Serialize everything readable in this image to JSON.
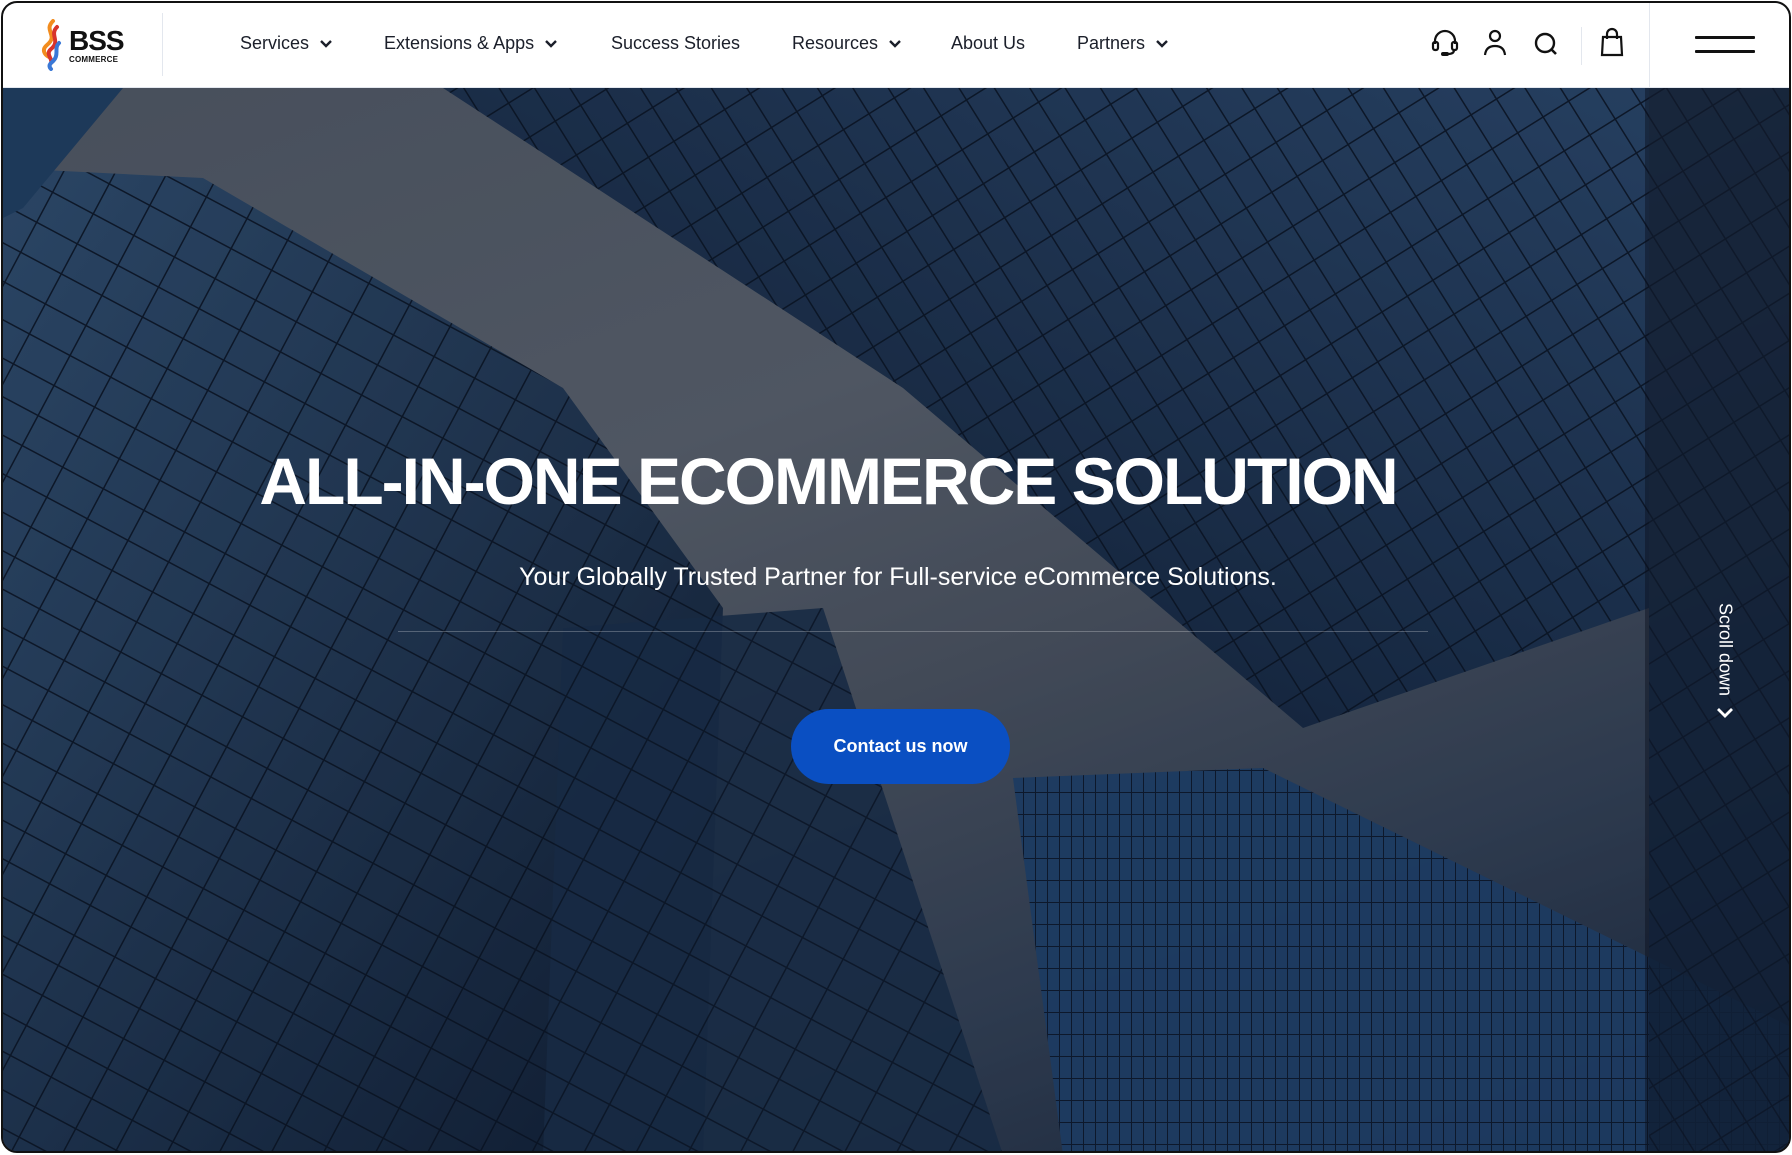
{
  "brand": {
    "name": "BSS",
    "subname": "COMMERCE",
    "logo_colors": [
      "#f28c1e",
      "#d8342b",
      "#3a78d6"
    ]
  },
  "nav": {
    "items": [
      {
        "label": "Services",
        "has_dropdown": true
      },
      {
        "label": "Extensions & Apps",
        "has_dropdown": true
      },
      {
        "label": "Success Stories",
        "has_dropdown": false
      },
      {
        "label": "Resources",
        "has_dropdown": true
      },
      {
        "label": "About Us",
        "has_dropdown": false
      },
      {
        "label": "Partners",
        "has_dropdown": true
      }
    ],
    "icons": [
      "headset-icon",
      "user-icon",
      "search-icon",
      "shopping-bag-icon",
      "hamburger-menu-icon"
    ]
  },
  "hero": {
    "title": "ALL-IN-ONE ECOMMERCE SOLUTION",
    "subtitle": "Your Globally Trusted Partner for Full-service eCommerce Solutions.",
    "cta_label": "Contact us now",
    "scroll_label": "Scroll down"
  },
  "colors": {
    "accent": "#0a4fc2",
    "header_bg": "#ffffff",
    "nav_text": "#1b1f2a",
    "hero_text": "#ffffff"
  }
}
